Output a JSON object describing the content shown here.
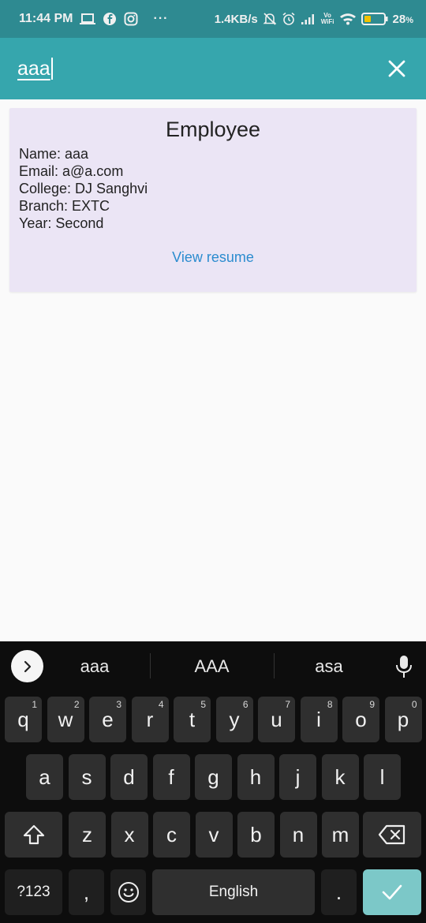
{
  "status_bar": {
    "time": "11:44 PM",
    "network_speed": "1.4KB/s",
    "volte_label_top": "Vo",
    "volte_label_bottom": "WiFi",
    "battery_percent": "28",
    "battery_percent_suffix": "%",
    "more_label": "···",
    "icons": [
      "laptop-icon",
      "facebook-icon",
      "instagram-icon",
      "mute-bell-icon",
      "alarm-icon",
      "signal-icon",
      "wifi-icon",
      "battery-icon"
    ]
  },
  "search": {
    "query": "aaa",
    "close_icon": "close-icon"
  },
  "card": {
    "title": "Employee",
    "name_line": "Name: aaa",
    "email_line": "Email: a@a.com",
    "college_line": "College: DJ Sanghvi",
    "branch_line": "Branch: EXTC",
    "year_line": "Year: Second",
    "action_label": "View resume",
    "background": "#ebe5f5",
    "link_color": "#2b8ccf"
  },
  "keyboard": {
    "suggestions": [
      "aaa",
      "AAA",
      "asa"
    ],
    "row1": [
      {
        "label": "q",
        "hint": "1"
      },
      {
        "label": "w",
        "hint": "2"
      },
      {
        "label": "e",
        "hint": "3"
      },
      {
        "label": "r",
        "hint": "4"
      },
      {
        "label": "t",
        "hint": "5"
      },
      {
        "label": "y",
        "hint": "6"
      },
      {
        "label": "u",
        "hint": "7"
      },
      {
        "label": "i",
        "hint": "8"
      },
      {
        "label": "o",
        "hint": "9"
      },
      {
        "label": "p",
        "hint": "0"
      }
    ],
    "row2": [
      "a",
      "s",
      "d",
      "f",
      "g",
      "h",
      "j",
      "k",
      "l"
    ],
    "row3": [
      "z",
      "x",
      "c",
      "v",
      "b",
      "n",
      "m"
    ],
    "symbols_label": "?123",
    "comma_label": ",",
    "space_label": "English",
    "period_label": ".",
    "accent_color": "#7cc8c8"
  },
  "theme": {
    "status_bar_color": "#2e8a91",
    "app_bar_color": "#36a6ad"
  }
}
